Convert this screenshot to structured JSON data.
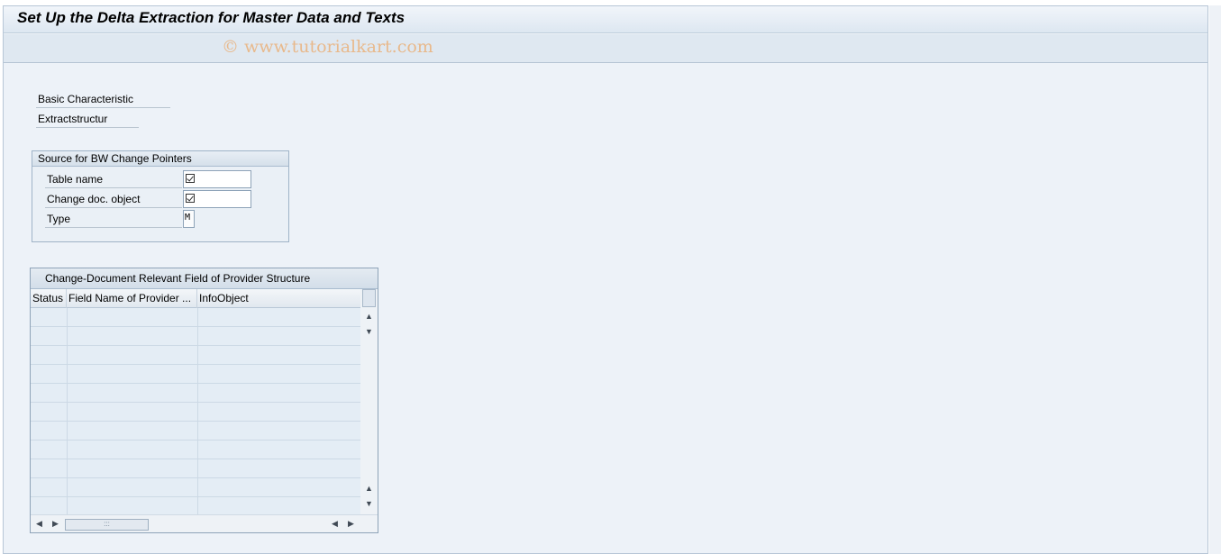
{
  "window": {
    "title": "Set Up the Delta Extraction for Master Data and Texts",
    "watermark": "© www.tutorialkart.com"
  },
  "header_fields": {
    "basic_characteristic_label": "Basic Characteristic",
    "extract_structure_label": "Extractstructur"
  },
  "source_group": {
    "title": "Source for BW Change Pointers",
    "fields": [
      {
        "label": "Table name",
        "value": ""
      },
      {
        "label": "Change doc. object",
        "value": ""
      },
      {
        "label": "Type",
        "value": "M"
      }
    ]
  },
  "table": {
    "title": "Change-Document Relevant Field of Provider Structure",
    "columns": [
      "Status",
      "Field Name of Provider ...",
      "InfoObject"
    ],
    "row_count": 11,
    "hthumb_grip": ":::"
  },
  "icons": {
    "checkbox": "checkbox-checked-icon",
    "scroll_up": "arrow-up-icon",
    "scroll_down": "arrow-down-icon",
    "scroll_left": "arrow-left-icon",
    "scroll_right": "arrow-right-icon"
  },
  "colors": {
    "background": "#edf2f8",
    "watermark": "#e8b98c"
  }
}
